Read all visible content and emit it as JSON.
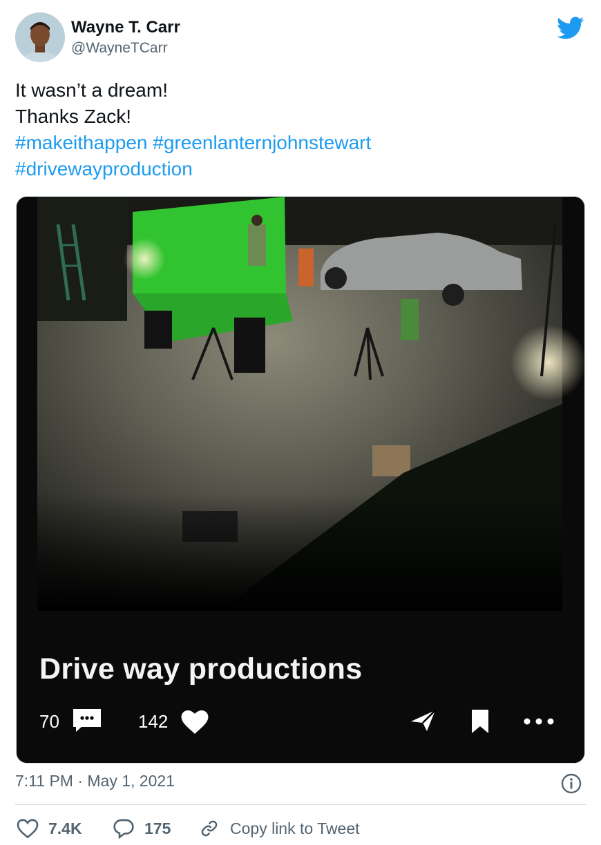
{
  "author": {
    "name": "Wayne T. Carr",
    "handle": "@WayneTCarr"
  },
  "tweet": {
    "line1": "It wasn’t a dream!",
    "line2": "Thanks Zack!",
    "hashtags": [
      "#makeithappen",
      "#greenlanternjohnstewart",
      "#drivewayproduction"
    ]
  },
  "media": {
    "caption": "Drive way productions",
    "comment_count": "70",
    "like_count": "142"
  },
  "footer": {
    "timestamp": "7:11 PM · May 1, 2021",
    "likes": "7.4K",
    "replies": "175",
    "copy_link_label": "Copy link to Tweet"
  },
  "colors": {
    "link": "#1d9bf0",
    "secondary_text": "#536471",
    "brand_blue": "#1d9bf0"
  },
  "icons": {
    "brand": "twitter-bird-icon",
    "media_comment": "comment-bubble-icon",
    "media_like": "heart-icon",
    "media_share": "paper-plane-icon",
    "media_save": "bookmark-icon",
    "media_more": "more-dots-icon",
    "info": "info-icon",
    "footer_like": "heart-outline-icon",
    "footer_reply": "reply-bubble-icon",
    "footer_copy": "link-icon"
  }
}
